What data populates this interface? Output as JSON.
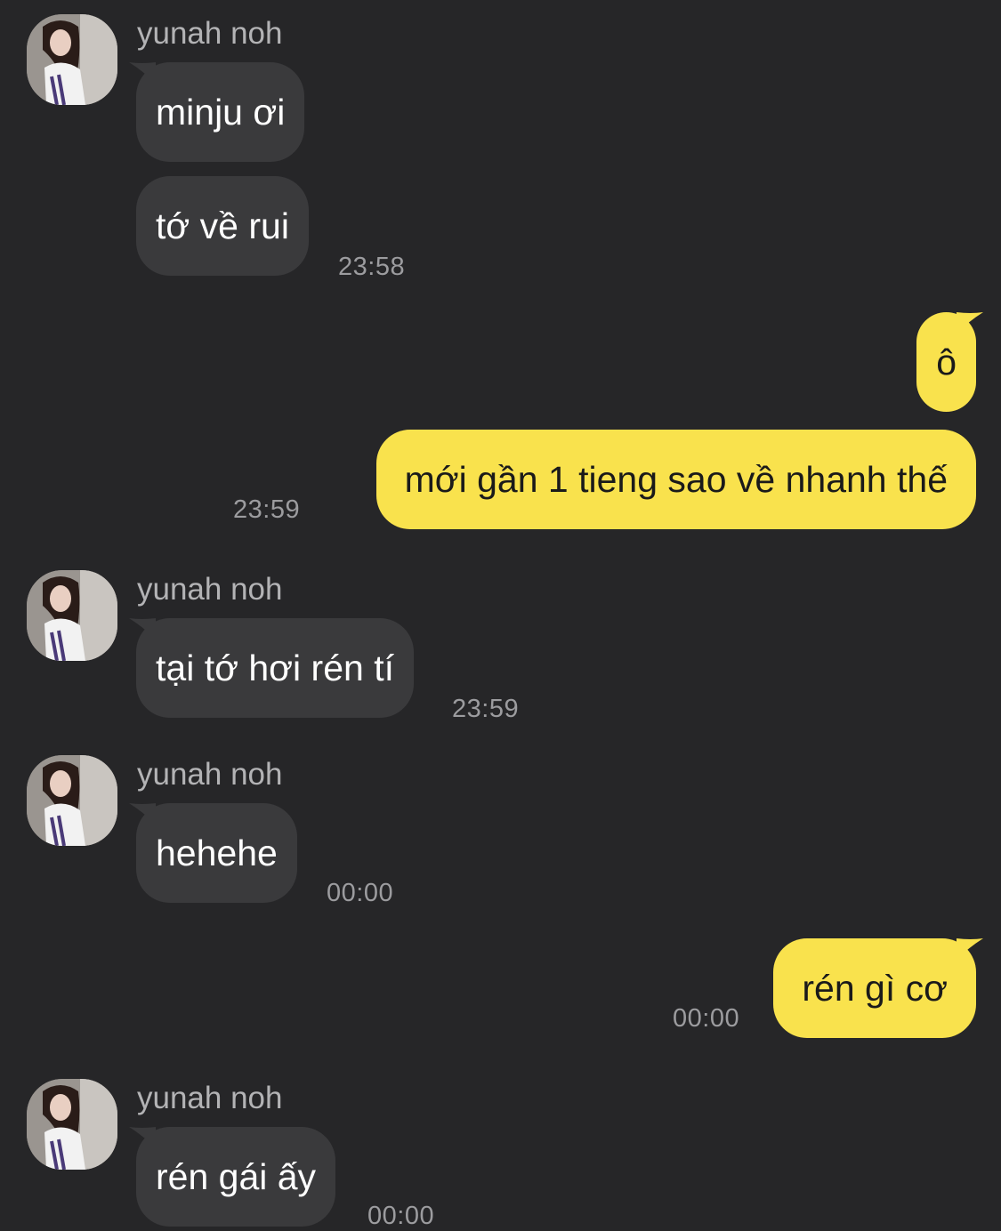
{
  "chat": {
    "contact_name": "yunah noh",
    "messages": [
      {
        "text": "minju ơi"
      },
      {
        "text": "tớ về rui",
        "time": "23:58"
      },
      {
        "text": "ô"
      },
      {
        "text": "mới gần 1 tieng sao về nhanh thế",
        "time": "23:59"
      },
      {
        "text": "tại tớ hơi rén tí",
        "time": "23:59"
      },
      {
        "text": "hehehe",
        "time": "00:00"
      },
      {
        "text": "rén gì cơ",
        "time": "00:00"
      },
      {
        "text": "rén gái ấy",
        "time": "00:00"
      }
    ]
  },
  "colors": {
    "background": "#262628",
    "incoming_bubble": "#3a3a3c",
    "outgoing_bubble": "#f9e24d",
    "timestamp": "#9c9c9f"
  }
}
